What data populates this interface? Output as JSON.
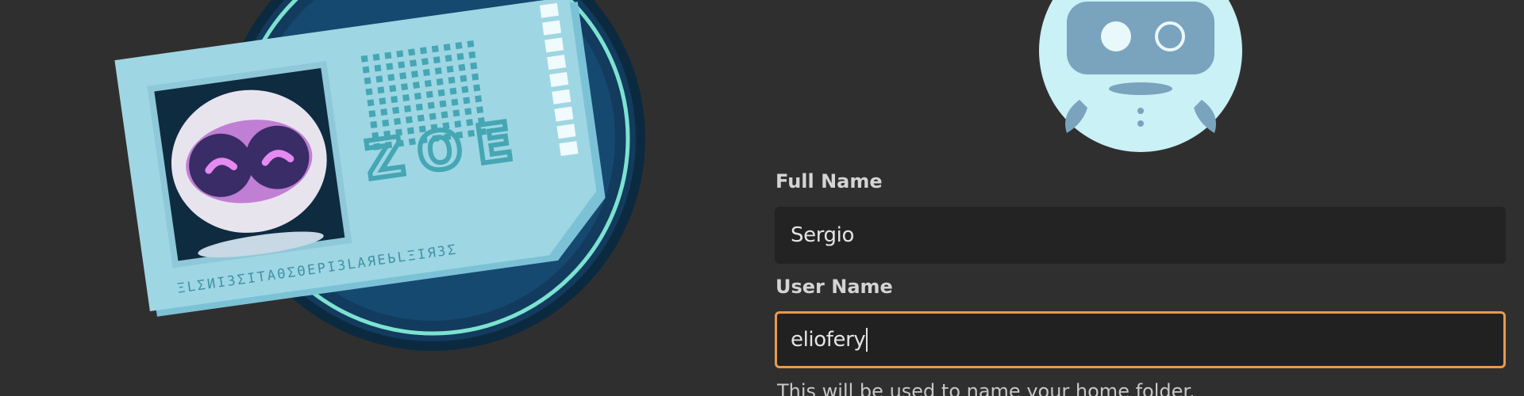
{
  "illustration": {
    "badge_title": "ZOE",
    "badge_glyph_caption": "ΞLΣИΙЗΣΙΤΑΘΣΘΕРΙЗLΑЯΕЬLΞΙЯЗΣ"
  },
  "form": {
    "full_name": {
      "label": "Full Name",
      "value": "Sergio"
    },
    "user_name": {
      "label": "User Name",
      "value": "eliofery",
      "hint": "This will be used to name your home folder."
    }
  },
  "colors": {
    "background": "#302f2f",
    "field_background": "#242323",
    "focus_accent": "#e79a4e",
    "badge_card": "#9fd6e3",
    "avatar_face": "#c9f1f6"
  }
}
